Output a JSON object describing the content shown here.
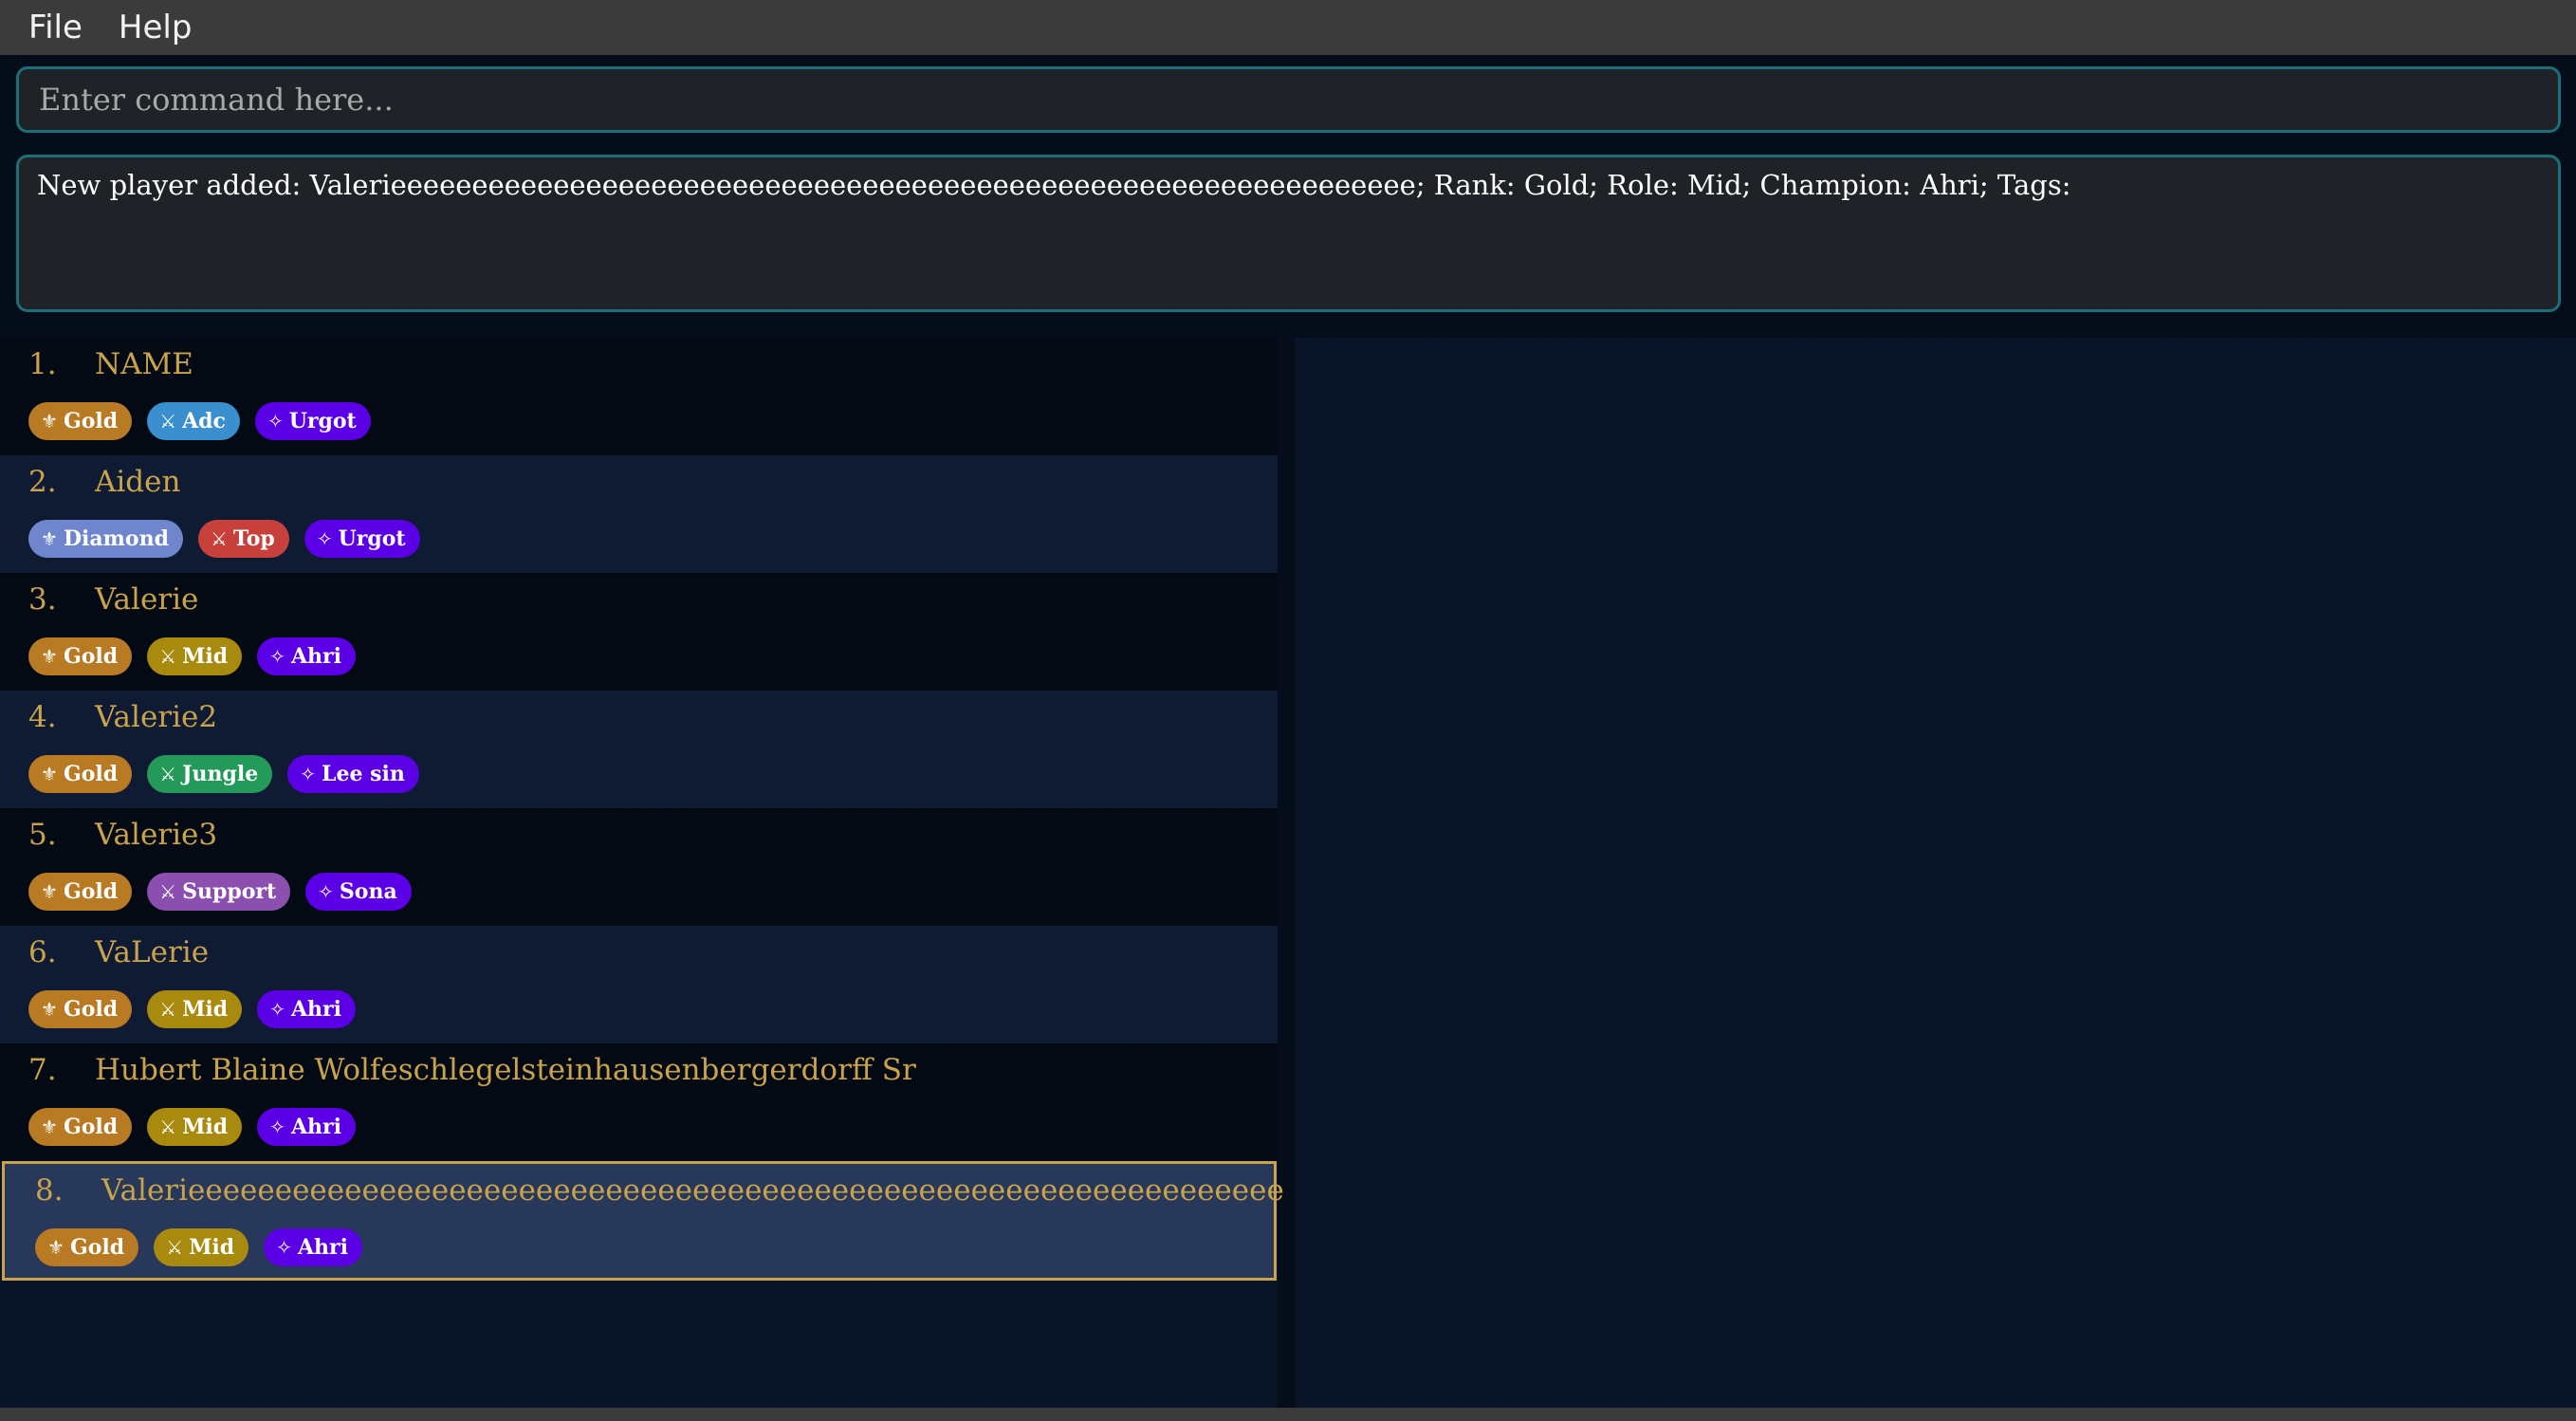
{
  "menu": {
    "file": "File",
    "help": "Help"
  },
  "command": {
    "placeholder": "Enter command here...",
    "value": ""
  },
  "result": {
    "text": "New player added: Valerieeeeeeeeeeeeeeeeeeeeeeeeeeeeeeeeeeeeeeeeeeeeeeeeeeeeeeeeeeeeeee; Rank: Gold; Role: Mid; Champion: Ahri; Tags:"
  },
  "colors": {
    "rank_gold": "#b87a23",
    "rank_diamond": "#6f86cf",
    "role_adc": "#3a8fcf",
    "role_top": "#c8403c",
    "role_mid": "#a88a0e",
    "role_jungle": "#249a5a",
    "role_support": "#8b4fb0",
    "champion": "#5b00e6",
    "name_text": "#c9a24c",
    "selected_border": "#c9a24c"
  },
  "icons": {
    "rank": "fleur-de-lis-icon",
    "role": "crossed-swords-icon",
    "champion": "sparkle-icon"
  },
  "players": [
    {
      "index": "1.",
      "name": "NAME",
      "rank": "Gold",
      "role": "Adc",
      "champion": "Urgot"
    },
    {
      "index": "2.",
      "name": "Aiden",
      "rank": "Diamond",
      "role": "Top",
      "champion": "Urgot"
    },
    {
      "index": "3.",
      "name": "Valerie",
      "rank": "Gold",
      "role": "Mid",
      "champion": "Ahri"
    },
    {
      "index": "4.",
      "name": "Valerie2",
      "rank": "Gold",
      "role": "Jungle",
      "champion": "Lee sin"
    },
    {
      "index": "5.",
      "name": "Valerie3",
      "rank": "Gold",
      "role": "Support",
      "champion": "Sona"
    },
    {
      "index": "6.",
      "name": "VaLerie",
      "rank": "Gold",
      "role": "Mid",
      "champion": "Ahri"
    },
    {
      "index": "7.",
      "name": "Hubert Blaine Wolfeschlegelsteinhausenbergerdorff Sr",
      "rank": "Gold",
      "role": "Mid",
      "champion": "Ahri"
    },
    {
      "index": "8.",
      "name": "Valerieeeeeeeeeeeeeeeeeeeeeeeeeeeeeeeeeeeeeeeeeeeeeeeeeeeeeeeeeeeeeee",
      "rank": "Gold",
      "role": "Mid",
      "champion": "Ahri"
    }
  ]
}
